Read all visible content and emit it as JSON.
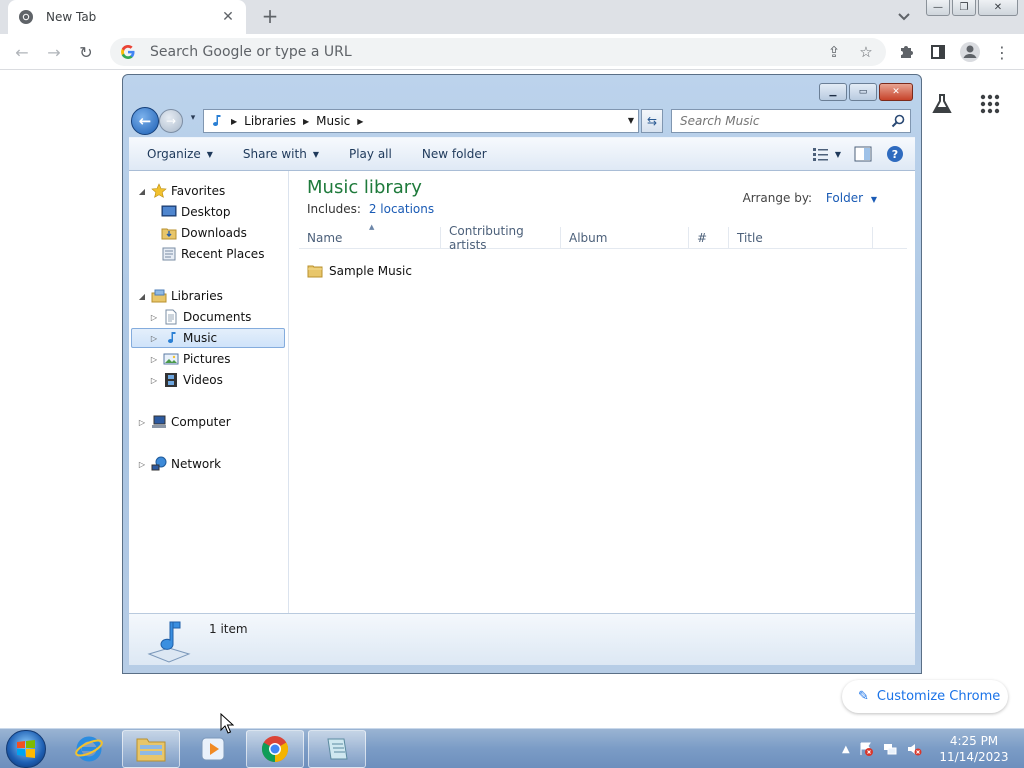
{
  "chrome": {
    "tab": {
      "title": "New Tab",
      "close": "✕"
    },
    "new_tab": "+",
    "tab_search": "⌄",
    "window_controls": {
      "minimize": "—",
      "restore": "❐",
      "close": "✕"
    },
    "toolbar": {
      "back": "←",
      "forward": "→",
      "reload": "↻",
      "omnibox_placeholder": "Search Google or type a URL",
      "share": "⇪",
      "bookmark": "☆",
      "extensions": "✱",
      "side_panel": "▯",
      "profile": "●",
      "menu": "⋮"
    },
    "customize": {
      "pencil": "✎",
      "label": "Customize Chrome"
    },
    "accent": "#1a73e8"
  },
  "explorer": {
    "controls": {
      "minimize": "▁",
      "maximize": "▭",
      "close": "✕"
    },
    "nav": {
      "back": "←",
      "forward": "→",
      "recent": "▾",
      "separator": "▶",
      "dropdown": "▼",
      "refresh": "⇆"
    },
    "breadcrumbs": [
      "Libraries",
      "Music"
    ],
    "search_placeholder": "Search Music",
    "commands": [
      {
        "label": "Organize",
        "caret": "▼"
      },
      {
        "label": "Share with",
        "caret": "▼"
      },
      {
        "label": "Play all",
        "caret": ""
      },
      {
        "label": "New folder",
        "caret": ""
      }
    ],
    "view_caret": "▼",
    "nav_pane": {
      "collapse_arrow": "◢",
      "expand_arrow": "▷",
      "favorites": {
        "label": "Favorites",
        "items": [
          "Desktop",
          "Downloads",
          "Recent Places"
        ]
      },
      "libraries": {
        "label": "Libraries",
        "items": [
          "Documents",
          "Music",
          "Pictures",
          "Videos"
        ]
      },
      "computer": "Computer",
      "network": "Network"
    },
    "library": {
      "title": "Music library",
      "includes_label": "Includes:",
      "locations_link": "2 locations",
      "arrange_label": "Arrange by:",
      "arrange_value": "Folder",
      "arrange_caret": "▼"
    },
    "columns": [
      "Name",
      "Contributing artists",
      "Album",
      "#",
      "Title"
    ],
    "sort_caret": "▲",
    "files": [
      {
        "name": "Sample Music"
      }
    ],
    "status": "1 item",
    "title_color": "#1e7a3b"
  },
  "taskbar": {
    "tray_up": "▲",
    "time": "4:25 PM",
    "date": "11/14/2023"
  }
}
